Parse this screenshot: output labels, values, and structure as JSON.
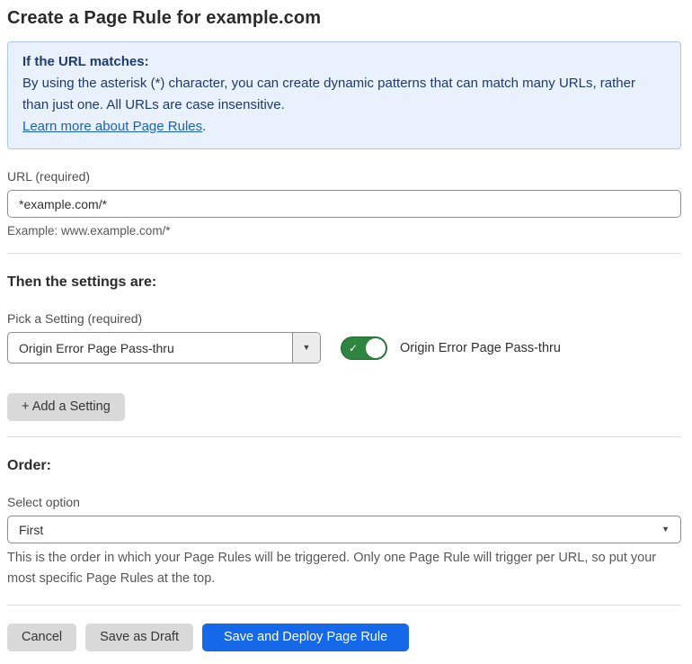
{
  "page": {
    "title": "Create a Page Rule for example.com"
  },
  "info_box": {
    "heading": "If the URL matches:",
    "body": "By using the asterisk (*) character, you can create dynamic patterns that can match many URLs, rather than just one. All URLs are case insensitive.",
    "link": "Learn more about Page Rules",
    "link_suffix": "."
  },
  "url_field": {
    "label": "URL (required)",
    "value": "*example.com/*",
    "helper": "Example: www.example.com/*"
  },
  "settings_section": {
    "heading": "Then the settings are:",
    "picker_label": "Pick a Setting (required)",
    "picker_value": "Origin Error Page Pass-thru",
    "toggle_label": "Origin Error Page Pass-thru",
    "toggle_state": "on",
    "add_button_label": "+ Add a Setting"
  },
  "order_section": {
    "heading": "Order:",
    "select_label": "Select option",
    "select_value": "First",
    "helper": "This is the order in which your Page Rules will be triggered. Only one Page Rule will trigger per URL, so put your most specific Page Rules at the top."
  },
  "footer": {
    "cancel_label": "Cancel",
    "save_draft_label": "Save as Draft",
    "save_deploy_label": "Save and Deploy Page Rule"
  },
  "icons": {
    "caret_down": "▼",
    "check": "✓"
  },
  "colors": {
    "accent_blue": "#1568e8",
    "toggle_green": "#2e8540",
    "info_box_bg": "#e9f2fc",
    "info_box_border": "#abc9ec",
    "info_box_text": "#1e3a6e",
    "link_blue": "#1b5fc4",
    "gray_button_bg": "#d9d9d9"
  }
}
